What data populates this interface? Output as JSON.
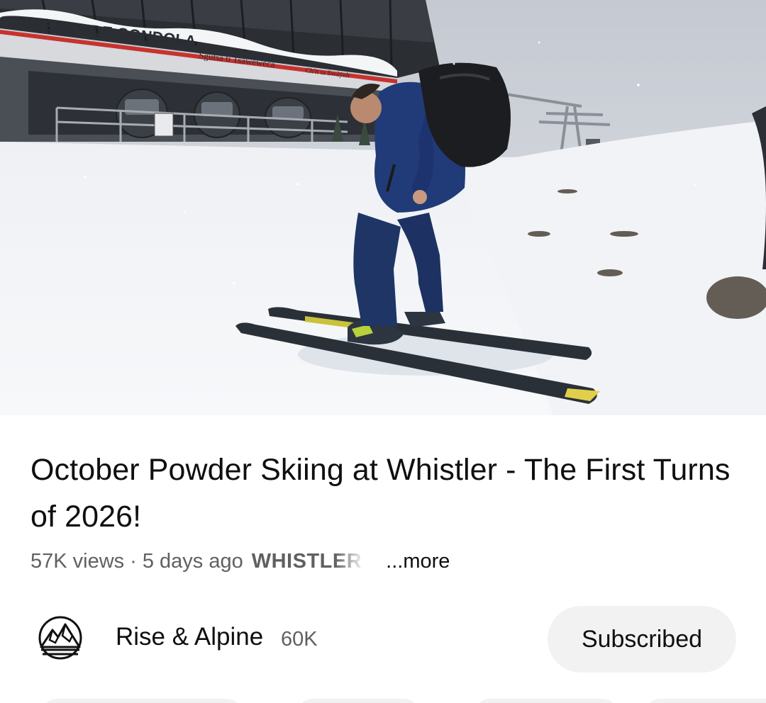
{
  "video": {
    "sign_main": "CREEKSIDE GONDOLA",
    "sign_sub1": "Sgútsa ti Tsawewéca",
    "sign_sub2": "Ch'it ta Swáẏelt"
  },
  "title": "October Powder Skiing at Whistler - The First Turns of 2026!",
  "meta": {
    "views": "57K views",
    "separator": "·",
    "age": "5 days ago",
    "tag": "WHISTLER",
    "more": "...more"
  },
  "channel": {
    "name": "Rise & Alpine",
    "subscribers": "60K",
    "button_label": "Subscribed",
    "avatar_icon": "mountain-logo-icon"
  },
  "colors": {
    "text_primary": "#0f0f0f",
    "text_secondary": "#606060",
    "button_bg": "#f2f2f2"
  }
}
